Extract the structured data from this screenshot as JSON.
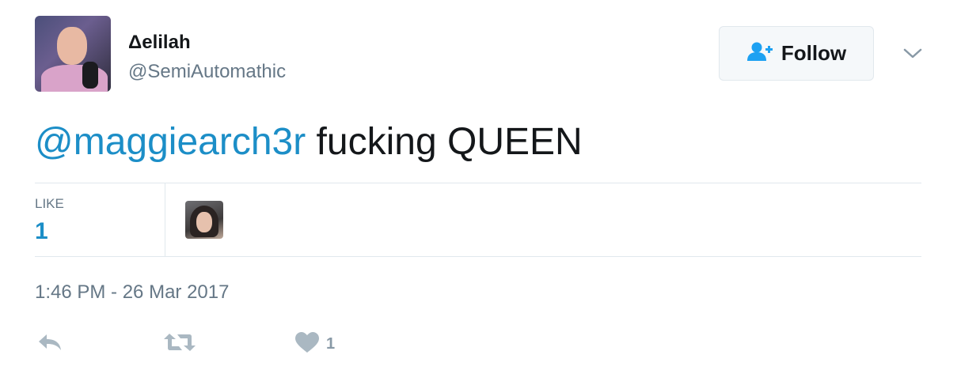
{
  "user": {
    "display_name": "Δelilah",
    "handle": "@SemiAutomathic"
  },
  "follow_button": {
    "label": "Follow",
    "icon": "follow-user-icon"
  },
  "tweet": {
    "mention": "@maggiearch3r",
    "text": " fucking QUEEN"
  },
  "stats": {
    "likes_label": "LIKE",
    "likes_count": "1"
  },
  "timestamp": "1:46 PM - 26 Mar 2017",
  "actions": {
    "reply_icon": "reply-icon",
    "retweet_icon": "retweet-icon",
    "like_icon": "heart-icon",
    "like_count": "1"
  },
  "colors": {
    "accent": "#1c8ec7",
    "follow_icon": "#1da1f2",
    "muted": "#657786",
    "action_icon": "#aab8c2"
  }
}
